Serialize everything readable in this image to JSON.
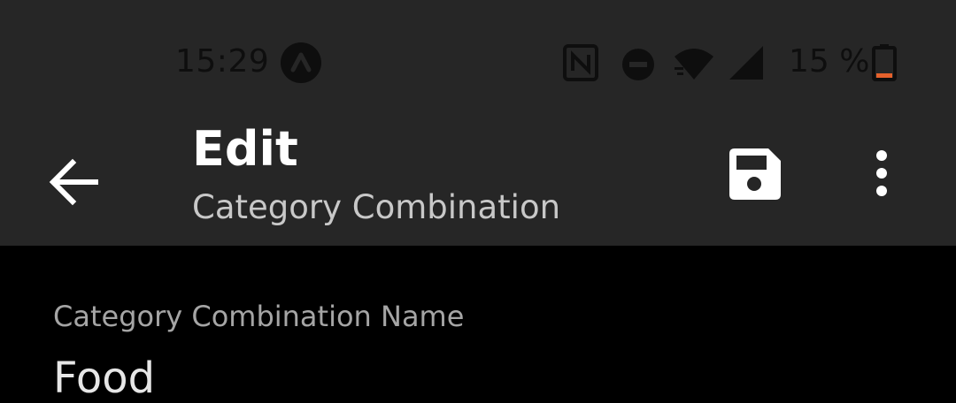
{
  "status_bar": {
    "time": "15:29",
    "battery_percent": "15 %",
    "icons": [
      "app-notification-icon",
      "nfc-icon",
      "do-not-disturb-icon",
      "wifi-icon",
      "cellular-signal-icon",
      "battery-low-icon"
    ],
    "battery_level": 0.15,
    "battery_accent": "#e5612c"
  },
  "toolbar": {
    "title": "Edit",
    "subtitle": "Category Combination",
    "back_icon": "arrow-back-icon",
    "save_icon": "save-icon",
    "more_icon": "more-vert-icon"
  },
  "form": {
    "name_label": "Category Combination Name",
    "name_value": "Food"
  },
  "colors": {
    "toolbar_bg": "#262626",
    "content_bg": "#000000",
    "text_primary": "#ffffff",
    "text_secondary": "#c8c8c8"
  }
}
